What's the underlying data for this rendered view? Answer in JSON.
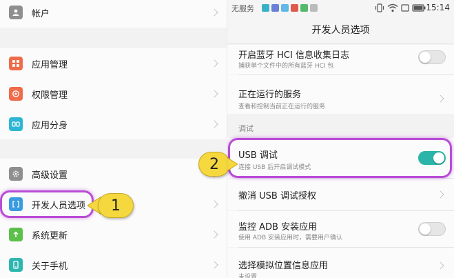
{
  "left_panel": {
    "items": [
      {
        "label": "帐户",
        "icon": "account-icon",
        "color": "#8f8f8f"
      },
      {
        "label": "应用管理",
        "icon": "app-manage-icon",
        "color": "#ef6b4a"
      },
      {
        "label": "权限管理",
        "icon": "permission-icon",
        "color": "#ef6b4a"
      },
      {
        "label": "应用分身",
        "icon": "app-twin-icon",
        "color": "#2db6d4"
      },
      {
        "label": "高级设置",
        "icon": "gear-icon",
        "color": "#8f8f8f"
      },
      {
        "label": "开发人员选项",
        "icon": "developer-icon",
        "color": "#3a9be0"
      },
      {
        "label": "系统更新",
        "icon": "system-update-icon",
        "color": "#5cbf4a"
      },
      {
        "label": "关于手机",
        "icon": "about-phone-icon",
        "color": "#2db6b0"
      }
    ]
  },
  "right_panel": {
    "status_bar": {
      "carrier": "无服务",
      "time": "15:14"
    },
    "title": "开发人员选项",
    "items": [
      {
        "title": "开启蓝牙 HCI 信息收集日志",
        "subtitle": "捕获单个文件中的所有蓝牙 HCI 包",
        "toggle": "off"
      },
      {
        "title": "正在运行的服务",
        "subtitle": "查看和控制当前正在运行的服务"
      },
      {
        "title": "USB 调试",
        "subtitle": "连接 USB 后开启调试模式",
        "toggle": "on"
      },
      {
        "title": "撤消 USB 调试授权"
      },
      {
        "title": "监控 ADB 安装应用",
        "subtitle": "使用 ADB 安装应用时，需要用户确认",
        "toggle": "off"
      },
      {
        "title": "选择模拟位置信息应用",
        "subtitle": "未设置"
      }
    ],
    "section_label": "调试"
  },
  "annotations": {
    "step1": "1",
    "step2": "2",
    "highlight_color": "#b84cd6",
    "callout_color": "#f4d83e"
  },
  "colors": {
    "toggle_on": "#2bb4a8"
  }
}
